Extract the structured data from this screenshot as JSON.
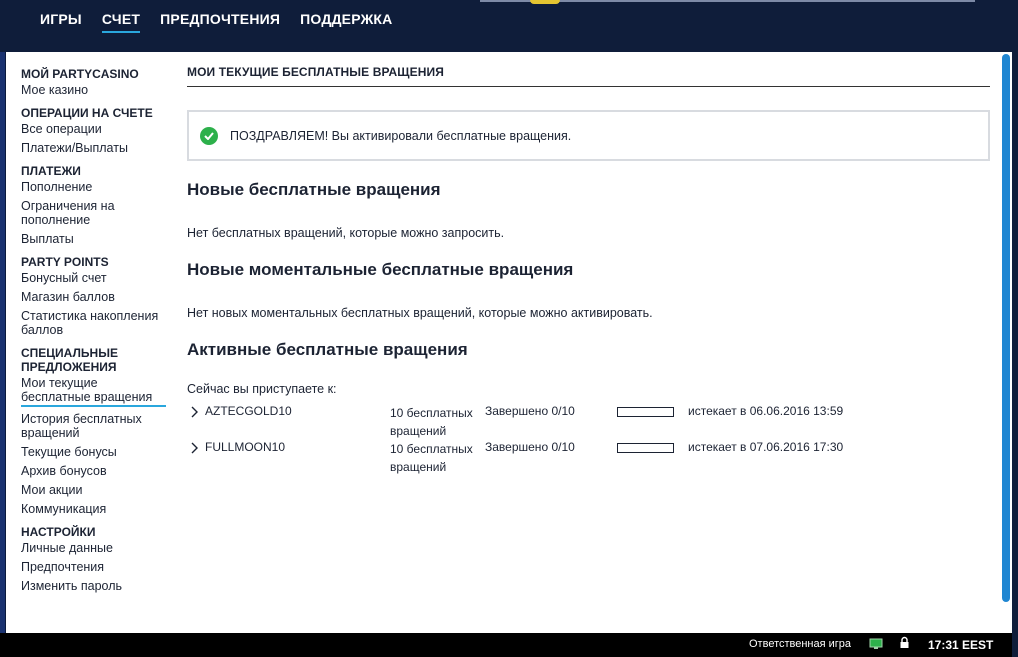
{
  "nav": {
    "items": [
      "ИГРЫ",
      "СЧЕТ",
      "ПРЕДПОЧТЕНИЯ",
      "ПОДДЕРЖКА"
    ],
    "active_index": 1
  },
  "sidebar": {
    "sections": [
      {
        "heading": "МОЙ PARTYCASINO",
        "links": [
          "Мое казино"
        ]
      },
      {
        "heading": "ОПЕРАЦИИ НА СЧЕТЕ",
        "links": [
          "Все операции",
          "Платежи/Выплаты"
        ]
      },
      {
        "heading": "ПЛАТЕЖИ",
        "links": [
          "Пополнение",
          "Ограничения на пополнение",
          "Выплаты"
        ]
      },
      {
        "heading": "PARTY POINTS",
        "links": [
          "Бонусный счет",
          "Магазин баллов",
          "Статистика накопления баллов"
        ]
      },
      {
        "heading": "СПЕЦИАЛЬНЫЕ ПРЕДЛОЖЕНИЯ",
        "links": [
          "Мои текущие бесплатные вращения",
          "История бесплатных вращений",
          "Текущие бонусы",
          "Архив бонусов",
          "Мои акции",
          "Коммуникация"
        ]
      },
      {
        "heading": "НАСТРОЙКИ",
        "links": [
          "Личные данные",
          "Предпочтения",
          "Изменить пароль"
        ]
      }
    ],
    "active_link": "Мои текущие бесплатные вращения"
  },
  "main": {
    "title": "МОИ ТЕКУЩИЕ БЕСПЛАТНЫЕ ВРАЩЕНИЯ",
    "alert": "ПОЗДРАВЛЯЕМ! Вы активировали бесплатные вращения.",
    "new_heading": "Новые бесплатные вращения",
    "new_text": "Нет бесплатных вращений, которые можно запросить.",
    "instant_heading": "Новые моментальные бесплатные вращения",
    "instant_text": "Нет новых моментальных бесплатных вращений, которые можно активировать.",
    "active_heading": "Активные бесплатные вращения",
    "active_lead": "Сейчас вы приступаете к:",
    "spins": [
      {
        "name": "AZTECGOLD10",
        "count": "10 бесплатных вращений",
        "status": "Завершено 0/10",
        "progress": 0,
        "expires": "истекает в 06.06.2016 13:59"
      },
      {
        "name": "FULLMOON10",
        "count": "10 бесплатных вращений",
        "status": "Завершено 0/10",
        "progress": 0,
        "expires": "истекает в 07.06.2016 17:30"
      }
    ]
  },
  "status": {
    "responsible": "Ответственная игра",
    "time": "17:31 EEST"
  },
  "colors": {
    "navy": "#0f1d3a",
    "accent_blue": "#2aa7dd",
    "success_green": "#2db04b",
    "scroll_blue": "#1f86d2"
  },
  "icons": [
    "check-circle-icon",
    "chevron-right-icon",
    "monitor-icon",
    "lock-icon"
  ]
}
